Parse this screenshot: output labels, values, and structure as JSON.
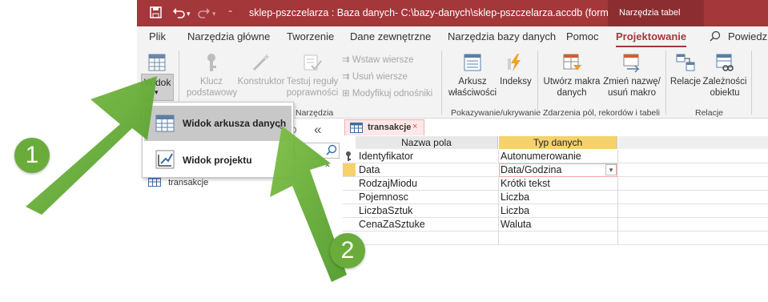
{
  "titlebar": {
    "title": "sklep-pszczelarza : Baza danych- C:\\bazy-danych\\sklep-pszczelarza.accdb (format pliku p...",
    "context_tab": "Narzędzia tabel"
  },
  "tabs": [
    "Plik",
    "Narzędzia główne",
    "Tworzenie",
    "Dane zewnętrzne",
    "Narzędzia bazy danych",
    "Pomoc",
    "Projektowanie"
  ],
  "active_tab": "Projektowanie",
  "search_placeholder": "Powiedz m",
  "ribbon": {
    "widok": "Widok",
    "widok_arrow": "▾",
    "klucz_line1": "Klucz",
    "klucz_line2": "podstawowy",
    "konstruktor": "Konstruktor",
    "testuj_line1": "Testuj reguły",
    "testuj_line2": "poprawności",
    "wstaw": "Wstaw wiersze",
    "usun": "Usuń wiersze",
    "modyfikuj": "Modyfikuj odnośniki",
    "group_narzedzia": "Narzędzia",
    "arkusz_line1": "Arkusz",
    "arkusz_line2": "właściwości",
    "indeksy": "Indeksy",
    "group_pokazywanie": "Pokazywanie/ukrywanie",
    "makra_line1": "Utwórz makra",
    "makra_line2": "danych",
    "zmien_line1": "Zmień nazwę/",
    "zmien_line2": "usuń makro",
    "group_zdarzenia": "Zdarzenia pól, rekordów i tabeli",
    "relacje": "Relacje",
    "zaleznosci_line1": "Zależności",
    "zaleznosci_line2": "obiektu",
    "group_relacje": "Relacje"
  },
  "view_menu": {
    "items": [
      "Widok arkusza danych",
      "Widok projektu"
    ]
  },
  "nav": {
    "collapse": "«",
    "section_toggle": "⌃",
    "item": "transakcje"
  },
  "doc_tab": {
    "label": "transakcje",
    "close": "×"
  },
  "grid": {
    "headers": [
      "Nazwa pola",
      "Typ danych"
    ],
    "rows": [
      {
        "name": "Identyfikator",
        "type": "Autonumerowanie"
      },
      {
        "name": "Data",
        "type": "Data/Godzina"
      },
      {
        "name": "RodzajMiodu",
        "type": "Krótki tekst"
      },
      {
        "name": "Pojemnosc",
        "type": "Liczba"
      },
      {
        "name": "LiczbaSztuk",
        "type": "Liczba"
      },
      {
        "name": "CenaZaSztuke",
        "type": "Waluta"
      }
    ]
  },
  "badges": [
    "1",
    "2"
  ],
  "colors": {
    "title_bar": "#a4373a",
    "active_tab": "#a4373a",
    "header_highlight": "#f5d26b",
    "badge": "#6aac3c"
  }
}
